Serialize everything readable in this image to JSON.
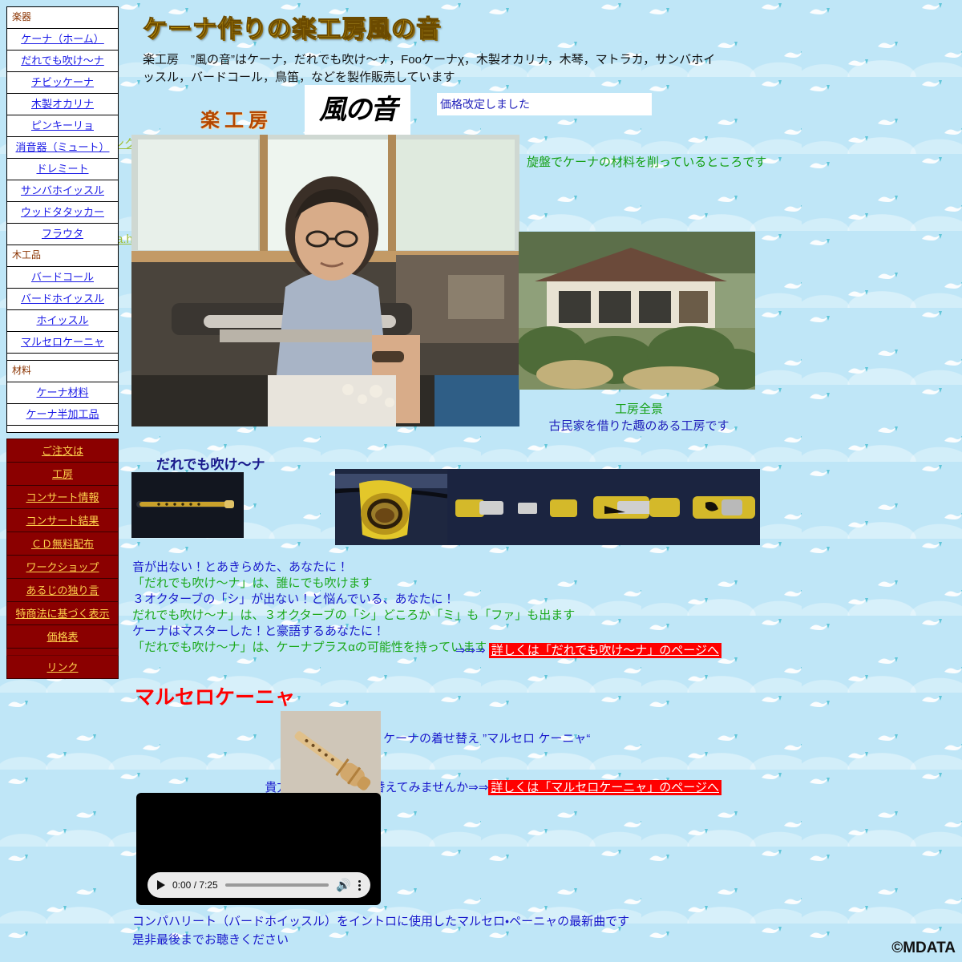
{
  "site": {
    "title": "ケーナ作りの楽工房風の音",
    "intro": "楽工房　”風の音”はケーナ，だれでも吹け〜ナ，Fooケーナχ，木製オカリナ，木琴，マトラカ，サンバホイッスル，バードコール，鳥笛，などを製作販売しています",
    "kobo_word": "楽工房",
    "kaze_logo_text": "風の音",
    "notice": "価格改定しました",
    "copyright": "©MDATA"
  },
  "sidebar": {
    "groups": [
      {
        "category": "楽器",
        "items": [
          {
            "label": "ケーナ（ホーム）"
          },
          {
            "label": "だれでも吹け〜ナ"
          },
          {
            "label": "チビッケーナ"
          },
          {
            "label": "木製オカリナ"
          },
          {
            "label": "ピンキーリョ"
          },
          {
            "label": "消音器（ミュート）"
          },
          {
            "label": "ドレミート"
          },
          {
            "label": "サンバホイッスル"
          },
          {
            "label": "ウッドタタッカー"
          },
          {
            "label": "フラウタ"
          }
        ]
      },
      {
        "category": "木工品",
        "items": [
          {
            "label": "バードコール"
          },
          {
            "label": "バードホイッスル"
          },
          {
            "label": "ホイッスル"
          },
          {
            "label": "マルセロケーニャ"
          }
        ]
      },
      {
        "category": "材料",
        "items": [
          {
            "label": "ケーナ材料"
          },
          {
            "label": "ケーナ半加工品"
          }
        ]
      }
    ],
    "order_menu": [
      {
        "label": "ご注文は"
      },
      {
        "label": "工房"
      },
      {
        "label": "コンサート情報"
      },
      {
        "label": "コンサート結果"
      },
      {
        "label": "ＣＤ無料配布"
      },
      {
        "label": "ワークショップ"
      },
      {
        "label": "あるじの独り言"
      },
      {
        "label": "特商法に基づく表示"
      },
      {
        "label": "価格表"
      },
      {
        "label": "リンク"
      }
    ]
  },
  "ghost_links": [
    {
      "label": "ンク"
    },
    {
      "label": "a.htmlへのリンク"
    }
  ],
  "main": {
    "lathe_caption": "旋盤でケーナの材料を削っているところです",
    "house_caption_green": "工房全景",
    "house_caption_blue": "古民家を借りた趣のある工房です",
    "dare": {
      "heading": "だれでも吹け〜ナ",
      "lines": [
        {
          "text": "音が出ない！とあきらめた、あなたに！",
          "color": "blue"
        },
        {
          "text": "「だれでも吹け〜ナ」は、誰にでも吹けます",
          "color": "green"
        },
        {
          "text": "３オクターブの「シ」が出ない！と悩んでいる、あなたに！",
          "color": "blue"
        },
        {
          "text": "だれでも吹け〜ナ」は、３オクターブの「シ」どころか「ミ」も「ファ」も出ます",
          "color": "green"
        },
        {
          "text": "ケーナはマスターした！と豪語するあなたに！",
          "color": "blue"
        },
        {
          "text": "「だれでも吹け〜ナ」は、ケーナプラスαの可能性を持っています",
          "color": "green"
        }
      ],
      "arrows": "⇒⇒⇒",
      "link": "詳しくは「だれでも吹け〜ナ」のページへ"
    },
    "marcelo": {
      "heading": "マルセロケーニャ",
      "caption": "ケーナの着せ替え ”マルセロ ケーニャ“",
      "prompt": "貴方のケーナも着せ替えてみませんか⇒⇒",
      "link": "詳しくは「マルセロケーニャ」のページへ"
    },
    "video": {
      "current_time": "0:00",
      "duration": "7:25",
      "time_display": "0:00 / 7:25",
      "play_label": "再生",
      "volume_label": "音量",
      "menu_label": "その他のオプション",
      "caption_line1": "コンパハリート（バードホイッスル）をイントロに使用したマルセロ・ペーニャの最新曲です",
      "caption_line2": "是非最後までお聴きください"
    }
  },
  "colors": {
    "sky": "#bfe6f7",
    "sidebar_link": "#1a1ae6",
    "category": "#8a3300",
    "order_bg": "#8b0000",
    "order_link": "#ffd24d",
    "title_gold": "#f5c518",
    "green_text": "#14a014",
    "blue_text": "#1a1acc",
    "red_highlight": "#ff0000",
    "marcelo_red": "#ff0000"
  }
}
